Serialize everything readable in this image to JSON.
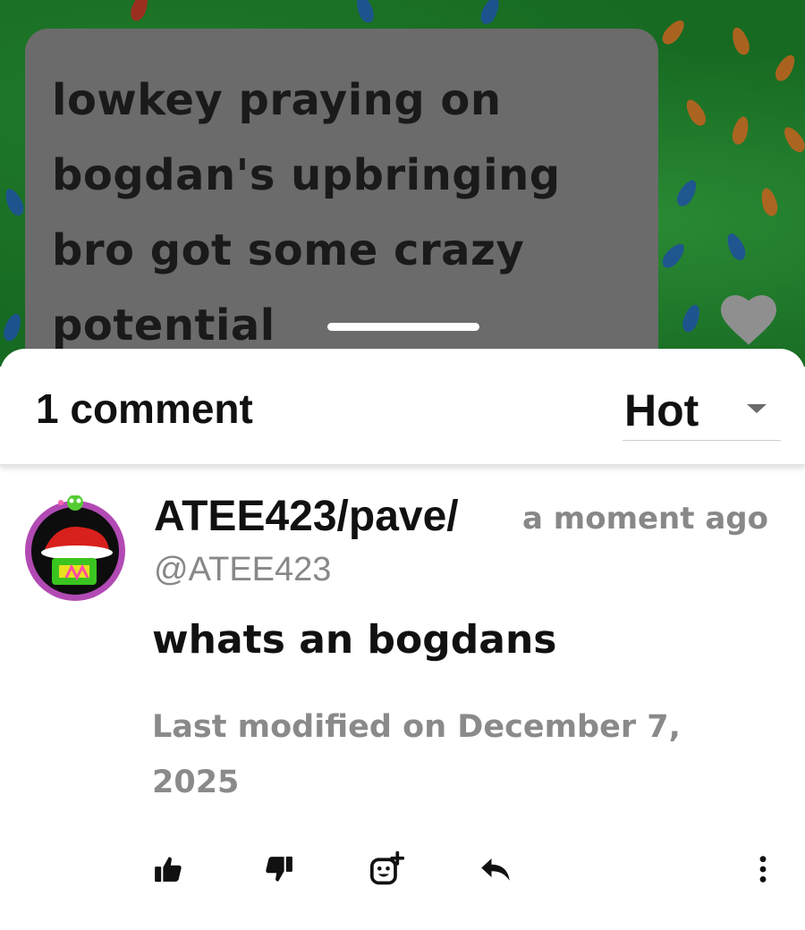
{
  "post": {
    "text": "lowkey praying on bogdan's upbringing bro got some crazy potential",
    "background_color": "#176a22",
    "card_color": "#6b6b6b",
    "like_icon": "heart-icon"
  },
  "comments_sheet": {
    "count_label": "1 comment",
    "sort": {
      "selected": "Hot"
    }
  },
  "comment": {
    "author": "ATEE423/pave/",
    "timestamp": "a moment ago",
    "handle": "@ATEE423",
    "body": "whats an bogdans",
    "last_modified": "Last modified on December 7, 2025",
    "actions": {
      "upvote_icon": "thumbs-up-icon",
      "downvote_icon": "thumbs-down-icon",
      "react_icon": "add-reaction-icon",
      "reply_icon": "reply-icon",
      "more_icon": "more-vertical-icon"
    }
  }
}
